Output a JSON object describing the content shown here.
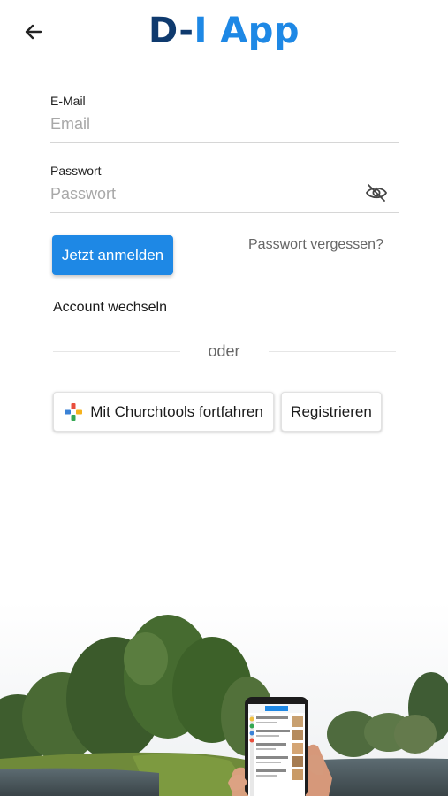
{
  "header": {
    "logo_part1": "D-",
    "logo_part2": "I App"
  },
  "form": {
    "email_label": "E-Mail",
    "email_placeholder": "Email",
    "password_label": "Passwort",
    "password_placeholder": "Passwort",
    "login_button": "Jetzt anmelden",
    "forgot_password": "Passwort vergessen?",
    "switch_account": "Account wechseln",
    "divider_text": "oder",
    "churchtools_button": "Mit Churchtools fortfahren",
    "register_button": "Registrieren"
  },
  "colors": {
    "primary": "#1e88e5",
    "logo_dark": "#0f3a6e"
  },
  "icons": {
    "back": "arrow-left-icon",
    "password_toggle": "eye-off-icon",
    "churchtools": "churchtools-logo-icon"
  }
}
